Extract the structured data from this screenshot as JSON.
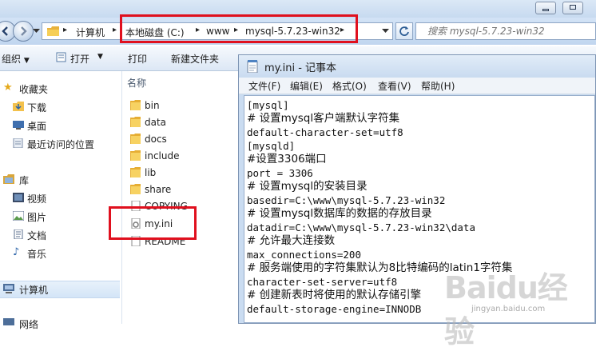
{
  "explorer": {
    "breadcrumbs": [
      "计算机",
      "本地磁盘 (C:)",
      "www",
      "mysql-5.7.23-win32"
    ],
    "search_placeholder": "搜索 mysql-5.7.23-win32",
    "toolbar": {
      "organize": "组织",
      "open": "打开",
      "print": "打印",
      "new_folder": "新建文件夹"
    },
    "sidebar": {
      "favorites": "收藏夹",
      "downloads": "下载",
      "desktop": "桌面",
      "recent": "最近访问的位置",
      "libraries": "库",
      "videos": "视频",
      "pictures": "图片",
      "documents": "文档",
      "music": "音乐",
      "computer": "计算机",
      "network": "网络"
    },
    "column_name": "名称",
    "files": [
      {
        "name": "bin",
        "type": "folder"
      },
      {
        "name": "data",
        "type": "folder"
      },
      {
        "name": "docs",
        "type": "folder"
      },
      {
        "name": "include",
        "type": "folder"
      },
      {
        "name": "lib",
        "type": "folder"
      },
      {
        "name": "share",
        "type": "folder"
      },
      {
        "name": "COPYING",
        "type": "file"
      },
      {
        "name": "my.ini",
        "type": "config"
      },
      {
        "name": "README",
        "type": "file"
      }
    ]
  },
  "notepad": {
    "title": "my.ini - 记事本",
    "menu": [
      "文件(F)",
      "编辑(E)",
      "格式(O)",
      "查看(V)",
      "帮助(H)"
    ],
    "lines": [
      "[mysql]",
      "# 设置mysql客户端默认字符集",
      "default-character-set=utf8",
      "[mysqld]",
      "#设置3306端口",
      "port = 3306",
      "# 设置mysql的安装目录",
      "basedir=C:\\www\\mysql-5.7.23-win32",
      "# 设置mysql数据库的数据的存放目录",
      "datadir=C:\\www\\mysql-5.7.23-win32\\data",
      "# 允许最大连接数",
      "max_connections=200",
      "# 服务端使用的字符集默认为8比特编码的latin1字符集",
      "character-set-server=utf8",
      "# 创建新表时将使用的默认存储引擎",
      "default-storage-engine=INNODB"
    ]
  },
  "watermark": {
    "logo": "Baidu经验",
    "url": "jingyan.baidu.com"
  },
  "colors": {
    "highlight": "#e0101e",
    "window_frame": "#cadcf1"
  }
}
